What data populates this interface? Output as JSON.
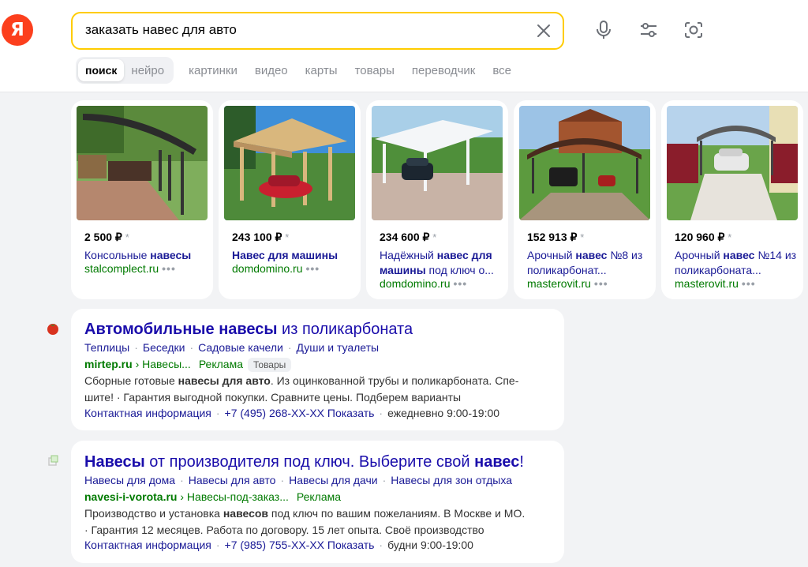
{
  "header": {
    "logo_letter": "Я",
    "query": "заказать навес для авто"
  },
  "tabs": {
    "group": [
      "поиск",
      "нейро"
    ],
    "plain": [
      "картинки",
      "видео",
      "карты",
      "товары",
      "переводчик",
      "все"
    ]
  },
  "products": [
    {
      "price": "2 500 ₽",
      "star": "*",
      "title_pre": "Консольные ",
      "title_bold": "навесы",
      "title_post": "",
      "site": "stalcomplect.ru",
      "dots": "•••"
    },
    {
      "price": "243 100 ₽",
      "star": "*",
      "title_pre": "",
      "title_bold": "Навес для машины",
      "title_post": "",
      "site": "domdomino.ru",
      "dots": "•••"
    },
    {
      "price": "234 600 ₽",
      "star": "*",
      "title_pre": "Надёжный ",
      "title_bold": "навес для машины",
      "title_post": " под ключ о...",
      "site": "domdomino.ru",
      "dots": "•••"
    },
    {
      "price": "152 913 ₽",
      "star": "*",
      "title_pre": "Арочный ",
      "title_bold": "навес",
      "title_post": " №8 из поликарбонат...",
      "site": "masterovit.ru",
      "dots": "•••"
    },
    {
      "price": "120 960 ₽",
      "star": "*",
      "title_pre": "Арочный ",
      "title_bold": "навес",
      "title_post": " №14 из поликарбоната...",
      "site": "masterovit.ru",
      "dots": "•••"
    }
  ],
  "results": [
    {
      "title_bold": "Автомобильные навесы",
      "title_rest": " из поликарбоната",
      "sitelinks": [
        "Теплицы",
        "Беседки",
        "Садовые качели",
        "Души и туалеты"
      ],
      "domain": "mirtep.ru",
      "path": " › Навесы...",
      "ad": "Реклама",
      "badge": "Товары",
      "snippet_pre": "Сборные готовые ",
      "snippet_bold": "навесы для авто",
      "snippet_post": ". Из оцинкованной трубы и поликарбоната. Спе-шите! · Гарантия выгодной покупки. Сравните цены. Подберем варианты",
      "contact_label": "Контактная информация",
      "phone": "+7 (495) 268-XX-XX Показать",
      "hours": "ежедневно 9:00-19:00"
    },
    {
      "title_bold1": "Навесы",
      "title_mid": " от производителя под ключ. Выберите свой ",
      "title_bold2": "навес",
      "title_end": "!",
      "sitelinks": [
        "Навесы для дома",
        "Навесы для авто",
        "Навесы для дачи",
        "Навесы для зон отдыха"
      ],
      "domain": "navesi-i-vorota.ru",
      "path": " › Навесы-под-заказ...",
      "ad": "Реклама",
      "snippet_pre": "Производство и установка ",
      "snippet_bold": "навесов",
      "snippet_post": " под ключ по вашим пожеланиям. В Москве и МО. · Гарантия 12 месяцев. Работа по договору. 15 лет опыта. Своё производство",
      "contact_label": "Контактная информация",
      "phone": "+7 (985) 755-XX-XX Показать",
      "hours": "будни 9:00-19:00"
    }
  ],
  "colors": {
    "accent": "#ffcc00",
    "logo": "#fc3f1d",
    "link": "#1a0dab",
    "url": "#007a00"
  },
  "icons": [
    "yandex-logo",
    "close-icon",
    "microphone-icon",
    "filters-icon",
    "camera-icon",
    "tomato-favicon",
    "square-favicon"
  ]
}
